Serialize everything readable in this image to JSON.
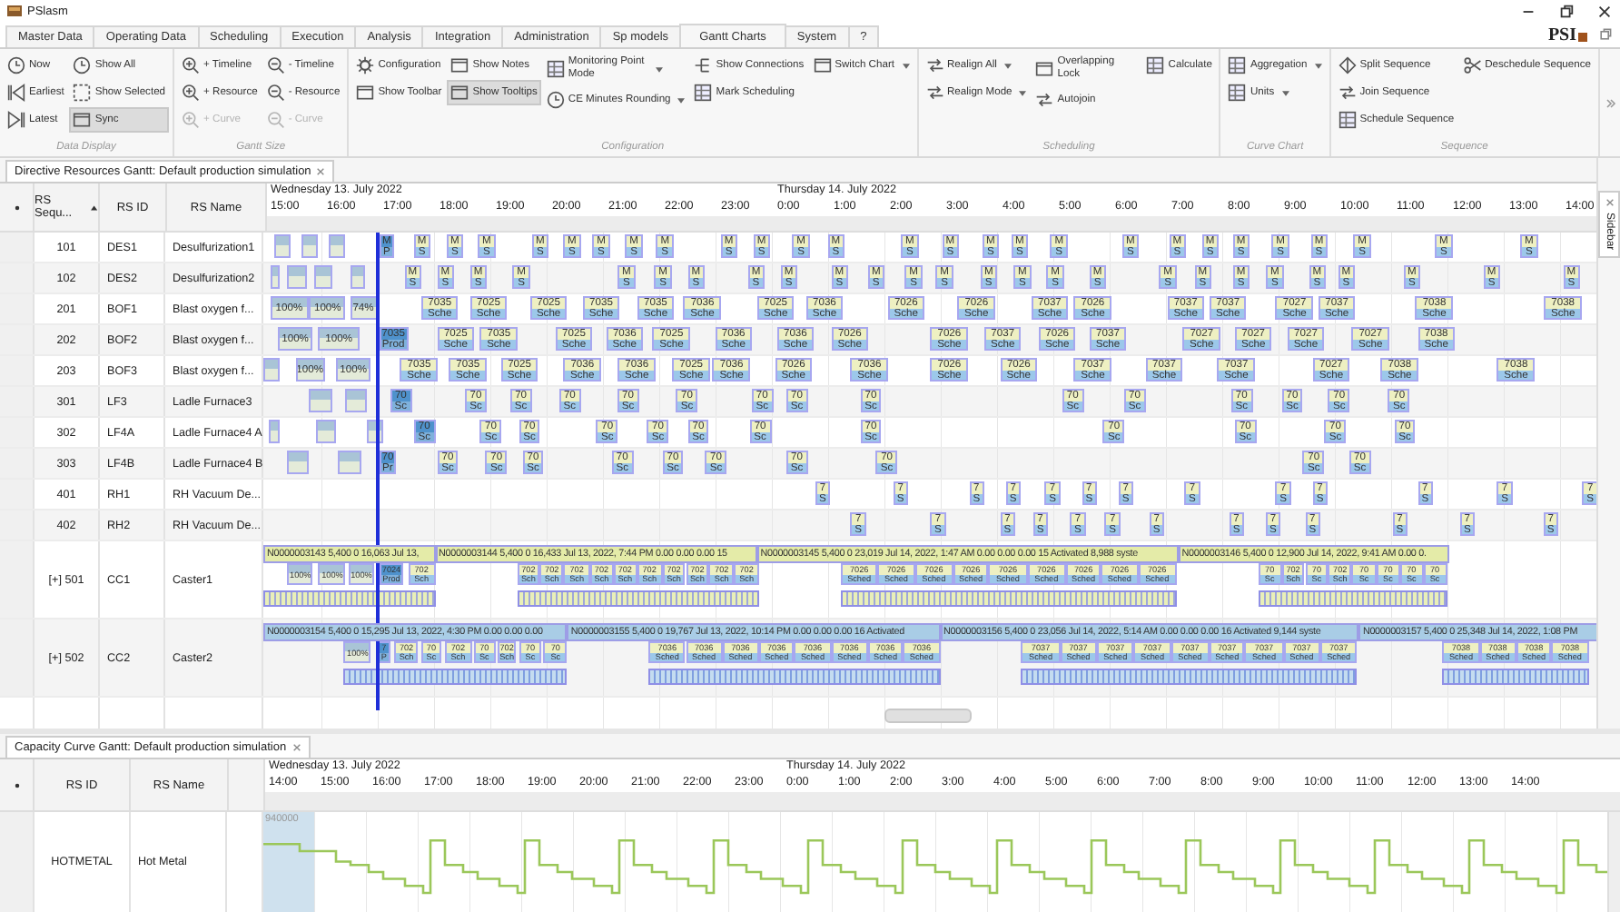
{
  "window": {
    "title": "PSlasm"
  },
  "logo": "PSI",
  "menu": [
    {
      "label": "Master Data",
      "selected": false
    },
    {
      "label": "Operating Data",
      "selected": false
    },
    {
      "label": "Scheduling",
      "selected": false
    },
    {
      "label": "Execution",
      "selected": false
    },
    {
      "label": "Analysis",
      "selected": false
    },
    {
      "label": "Integration",
      "selected": false
    },
    {
      "label": "Administration",
      "selected": false
    },
    {
      "label": "Sp models",
      "selected": false
    },
    {
      "label": "Gantt Charts",
      "selected": true
    },
    {
      "label": "System",
      "selected": false
    },
    {
      "label": "?",
      "selected": false
    }
  ],
  "ribbon": [
    {
      "label": "Data Display",
      "columns": [
        [
          {
            "label": "Now",
            "on": false,
            "disabled": false,
            "dropdown": false
          },
          {
            "label": "Earliest",
            "on": false,
            "disabled": false,
            "dropdown": false
          },
          {
            "label": "Latest",
            "on": false,
            "disabled": false,
            "dropdown": false
          }
        ],
        [
          {
            "label": "Show All",
            "on": false,
            "disabled": false,
            "dropdown": false
          },
          {
            "label": "Show Selected",
            "on": false,
            "disabled": false,
            "dropdown": false
          },
          {
            "label": "Sync",
            "on": true,
            "disabled": false,
            "dropdown": false
          }
        ]
      ]
    },
    {
      "label": "Gantt Size",
      "columns": [
        [
          {
            "label": "+ Timeline",
            "on": false,
            "disabled": false,
            "dropdown": false
          },
          {
            "label": "+ Resource",
            "on": false,
            "disabled": false,
            "dropdown": false
          },
          {
            "label": "+ Curve",
            "on": false,
            "disabled": true,
            "dropdown": false
          }
        ],
        [
          {
            "label": "- Timeline",
            "on": false,
            "disabled": false,
            "dropdown": false
          },
          {
            "label": "- Resource",
            "on": false,
            "disabled": false,
            "dropdown": false
          },
          {
            "label": "- Curve",
            "on": false,
            "disabled": true,
            "dropdown": false
          }
        ]
      ]
    },
    {
      "label": "Configuration",
      "columns": [
        [
          {
            "label": "Configuration",
            "on": false,
            "disabled": false,
            "dropdown": false
          },
          {
            "label": "Show Toolbar",
            "on": false,
            "disabled": false,
            "dropdown": false
          }
        ],
        [
          {
            "label": "Show Notes",
            "on": false,
            "disabled": false,
            "dropdown": false
          },
          {
            "label": "Show Tooltips",
            "on": true,
            "disabled": false,
            "dropdown": false
          }
        ],
        [
          {
            "label": "Monitoring Point Mode",
            "on": false,
            "disabled": false,
            "dropdown": true
          },
          {
            "label": "CE Minutes Rounding",
            "on": false,
            "disabled": false,
            "dropdown": true
          }
        ],
        [
          {
            "label": "Show Connections",
            "on": false,
            "disabled": false,
            "dropdown": false
          },
          {
            "label": "Mark Scheduling",
            "on": false,
            "disabled": false,
            "dropdown": false
          }
        ],
        [
          {
            "label": "Switch Chart",
            "on": false,
            "disabled": false,
            "dropdown": true
          }
        ]
      ]
    },
    {
      "label": "Scheduling",
      "columns": [
        [
          {
            "label": "Realign All",
            "on": false,
            "disabled": false,
            "dropdown": true
          },
          {
            "label": "Realign Mode",
            "on": false,
            "disabled": false,
            "dropdown": true
          }
        ],
        [
          {
            "label": "Overlapping Lock",
            "on": false,
            "disabled": false,
            "dropdown": false
          },
          {
            "label": "Autojoin",
            "on": false,
            "disabled": false,
            "dropdown": false
          }
        ],
        [
          {
            "label": "Calculate",
            "on": false,
            "disabled": false,
            "dropdown": false
          }
        ]
      ]
    },
    {
      "label": "Curve Chart",
      "columns": [
        [
          {
            "label": "Aggregation",
            "on": false,
            "disabled": false,
            "dropdown": true
          },
          {
            "label": "Units",
            "on": false,
            "disabled": false,
            "dropdown": true
          }
        ]
      ]
    },
    {
      "label": "Sequence",
      "columns": [
        [
          {
            "label": "Split Sequence",
            "on": false,
            "disabled": false,
            "dropdown": false
          },
          {
            "label": "Join Sequence",
            "on": false,
            "disabled": false,
            "dropdown": false
          },
          {
            "label": "Schedule Sequence",
            "on": false,
            "disabled": false,
            "dropdown": false
          }
        ],
        [
          {
            "label": "Deschedule Sequence",
            "on": false,
            "disabled": false,
            "dropdown": false
          }
        ]
      ]
    }
  ],
  "resources_gantt": {
    "title": "Directive Resources Gantt: Default production simulation",
    "columns": [
      "RS Sequ...",
      "RS ID",
      "RS Name"
    ],
    "days": [
      {
        "label": "Wednesday 13. July 2022",
        "hours": [
          "15:00",
          "16:00",
          "17:00",
          "18:00",
          "19:00",
          "20:00",
          "21:00",
          "22:00",
          "23:00"
        ]
      },
      {
        "label": "Thursday 14. July 2022",
        "hours": [
          "0:00",
          "1:00",
          "2:00",
          "3:00",
          "4:00",
          "5:00",
          "6:00",
          "7:00",
          "8:00",
          "9:00",
          "10:00",
          "11:00",
          "12:00",
          "13:00",
          "14:00"
        ]
      }
    ],
    "rows": [
      {
        "kind": "unit",
        "sequence": "101",
        "id": "DES1",
        "name": "Desulfurization1",
        "bars": [
          {
            "kind": "done"
          },
          {
            "kind": "done"
          },
          {
            "kind": "done"
          },
          {
            "kind": "active",
            "label": "M",
            "sub": "P"
          },
          {
            "kind": "plan",
            "label": "M",
            "sub": "S"
          },
          {
            "kind": "plan",
            "label": "M",
            "sub": "S"
          },
          {
            "kind": "plan",
            "label": "M",
            "sub": "S"
          },
          {
            "kind": "plan",
            "label": "M",
            "sub": "S"
          },
          {
            "kind": "plan",
            "label": "M",
            "sub": "S"
          },
          {
            "kind": "plan",
            "label": "M",
            "sub": "S"
          },
          {
            "kind": "plan",
            "label": "M",
            "sub": "S"
          },
          {
            "kind": "plan",
            "label": "M",
            "sub": "S"
          },
          {
            "kind": "plan",
            "label": "M",
            "sub": "S"
          },
          {
            "kind": "plan",
            "label": "M",
            "sub": "S"
          },
          {
            "kind": "plan",
            "label": "M",
            "sub": "S"
          },
          {
            "kind": "plan",
            "label": "M",
            "sub": "S"
          },
          {
            "kind": "plan",
            "label": "M",
            "sub": "S"
          },
          {
            "kind": "plan",
            "label": "M",
            "sub": "S"
          },
          {
            "kind": "plan",
            "label": "M",
            "sub": "S"
          },
          {
            "kind": "plan",
            "label": "M",
            "sub": "S"
          },
          {
            "kind": "plan",
            "label": "M",
            "sub": "S"
          },
          {
            "kind": "plan",
            "label": "M",
            "sub": "S"
          },
          {
            "kind": "plan",
            "label": "M",
            "sub": "S"
          },
          {
            "kind": "plan",
            "label": "M",
            "sub": "S"
          },
          {
            "kind": "plan",
            "label": "M",
            "sub": "S"
          },
          {
            "kind": "plan",
            "label": "M",
            "sub": "S"
          },
          {
            "kind": "plan",
            "label": "M",
            "sub": "S"
          },
          {
            "kind": "plan",
            "label": "M",
            "sub": "S"
          },
          {
            "kind": "plan",
            "label": "M",
            "sub": "S"
          },
          {
            "kind": "plan",
            "label": "M",
            "sub": "S"
          }
        ]
      },
      {
        "kind": "unit",
        "sequence": "102",
        "id": "DES2",
        "name": "Desulfurization2",
        "bars": [
          {
            "kind": "done"
          },
          {
            "kind": "done"
          },
          {
            "kind": "done"
          },
          {
            "kind": "done"
          },
          {
            "kind": "plan",
            "label": "M",
            "sub": "S"
          },
          {
            "kind": "plan",
            "label": "M",
            "sub": "S"
          },
          {
            "kind": "plan",
            "label": "M",
            "sub": "S"
          },
          {
            "kind": "plan",
            "label": "M",
            "sub": "S"
          },
          {
            "kind": "plan",
            "label": "M",
            "sub": "S"
          },
          {
            "kind": "plan",
            "label": "M",
            "sub": "S"
          },
          {
            "kind": "plan",
            "label": "M",
            "sub": "S"
          },
          {
            "kind": "plan",
            "label": "M",
            "sub": "S"
          },
          {
            "kind": "plan",
            "label": "M",
            "sub": "S"
          },
          {
            "kind": "plan",
            "label": "M",
            "sub": "S"
          },
          {
            "kind": "plan",
            "label": "M",
            "sub": "S"
          },
          {
            "kind": "plan",
            "label": "M",
            "sub": "S"
          },
          {
            "kind": "plan",
            "label": "M",
            "sub": "S"
          },
          {
            "kind": "plan",
            "label": "M",
            "sub": "S"
          },
          {
            "kind": "plan",
            "label": "M",
            "sub": "S"
          },
          {
            "kind": "plan",
            "label": "M",
            "sub": "S"
          },
          {
            "kind": "plan",
            "label": "M",
            "sub": "S"
          },
          {
            "kind": "plan",
            "label": "M",
            "sub": "S"
          },
          {
            "kind": "plan",
            "label": "M",
            "sub": "S"
          },
          {
            "kind": "plan",
            "label": "M",
            "sub": "S"
          },
          {
            "kind": "plan",
            "label": "M",
            "sub": "S"
          },
          {
            "kind": "plan",
            "label": "M",
            "sub": "S"
          },
          {
            "kind": "plan",
            "label": "M",
            "sub": "S"
          },
          {
            "kind": "plan",
            "label": "M",
            "sub": "S"
          },
          {
            "kind": "plan",
            "label": "M",
            "sub": "S"
          },
          {
            "kind": "plan",
            "label": "M",
            "sub": "S"
          }
        ]
      },
      {
        "kind": "unit",
        "sequence": "201",
        "id": "BOF1",
        "name": "Blast oxygen f...",
        "bars": [
          {
            "kind": "done",
            "label": "100%"
          },
          {
            "kind": "done",
            "label": "100%"
          },
          {
            "kind": "done",
            "label": "74%"
          },
          {
            "kind": "plan",
            "label": "7035",
            "sub": "Sche"
          },
          {
            "kind": "plan",
            "label": "7025",
            "sub": "Sche"
          },
          {
            "kind": "plan",
            "label": "7025",
            "sub": "Sche"
          },
          {
            "kind": "plan",
            "label": "7035",
            "sub": "Sche"
          },
          {
            "kind": "plan",
            "label": "7035",
            "sub": "Sche"
          },
          {
            "kind": "plan",
            "label": "7036",
            "sub": "Sche"
          },
          {
            "kind": "plan",
            "label": "7025",
            "sub": "Sche"
          },
          {
            "kind": "plan",
            "label": "7036",
            "sub": "Sche"
          },
          {
            "kind": "plan",
            "label": "7026",
            "sub": "Sche"
          },
          {
            "kind": "plan",
            "label": "7026",
            "sub": "Sche"
          },
          {
            "kind": "plan",
            "label": "7037",
            "sub": "Sche"
          },
          {
            "kind": "plan",
            "label": "7026",
            "sub": "Sche"
          },
          {
            "kind": "plan",
            "label": "7037",
            "sub": "Sche"
          },
          {
            "kind": "plan",
            "label": "7037",
            "sub": "Sche"
          },
          {
            "kind": "plan",
            "label": "7027",
            "sub": "Sche"
          },
          {
            "kind": "plan",
            "label": "7037",
            "sub": "Sche"
          },
          {
            "kind": "plan",
            "label": "7038",
            "sub": "Sche"
          },
          {
            "kind": "plan",
            "label": "7038",
            "sub": "Sche"
          }
        ]
      },
      {
        "kind": "unit",
        "sequence": "202",
        "id": "BOF2",
        "name": "Blast oxygen f...",
        "bars": [
          {
            "kind": "done",
            "label": "100%"
          },
          {
            "kind": "done",
            "label": "100%"
          },
          {
            "kind": "active",
            "label": "7035",
            "sub": "Prod"
          },
          {
            "kind": "plan",
            "label": "7025",
            "sub": "Sche"
          },
          {
            "kind": "plan",
            "label": "7035",
            "sub": "Sche"
          },
          {
            "kind": "plan",
            "label": "7025",
            "sub": "Sche"
          },
          {
            "kind": "plan",
            "label": "7036",
            "sub": "Sche"
          },
          {
            "kind": "plan",
            "label": "7025",
            "sub": "Sche"
          },
          {
            "kind": "plan",
            "label": "7036",
            "sub": "Sche"
          },
          {
            "kind": "plan",
            "label": "7036",
            "sub": "Sche"
          },
          {
            "kind": "plan",
            "label": "7026",
            "sub": "Sche"
          },
          {
            "kind": "plan",
            "label": "7026",
            "sub": "Sche"
          },
          {
            "kind": "plan",
            "label": "7037",
            "sub": "Sche"
          },
          {
            "kind": "plan",
            "label": "7026",
            "sub": "Sche"
          },
          {
            "kind": "plan",
            "label": "7037",
            "sub": "Sche"
          },
          {
            "kind": "plan",
            "label": "7027",
            "sub": "Sche"
          },
          {
            "kind": "plan",
            "label": "7027",
            "sub": "Sche"
          },
          {
            "kind": "plan",
            "label": "7027",
            "sub": "Sche"
          },
          {
            "kind": "plan",
            "label": "7027",
            "sub": "Sche"
          },
          {
            "kind": "plan",
            "label": "7038",
            "sub": "Sche"
          }
        ]
      },
      {
        "kind": "unit",
        "sequence": "203",
        "id": "BOF3",
        "name": "Blast oxygen f...",
        "bars": [
          {
            "kind": "done"
          },
          {
            "kind": "done",
            "label": "100%"
          },
          {
            "kind": "done",
            "label": "100%"
          },
          {
            "kind": "plan",
            "label": "7035",
            "sub": "Sche"
          },
          {
            "kind": "plan",
            "label": "7035",
            "sub": "Sche"
          },
          {
            "kind": "plan",
            "label": "7025",
            "sub": "Sche"
          },
          {
            "kind": "plan",
            "label": "7036",
            "sub": "Sche"
          },
          {
            "kind": "plan",
            "label": "7036",
            "sub": "Sche"
          },
          {
            "kind": "plan",
            "label": "7025",
            "sub": "Sche"
          },
          {
            "kind": "plan",
            "label": "7036",
            "sub": "Sche"
          },
          {
            "kind": "plan",
            "label": "7026",
            "sub": "Sche"
          },
          {
            "kind": "plan",
            "label": "7036",
            "sub": "Sche"
          },
          {
            "kind": "plan",
            "label": "7026",
            "sub": "Sche"
          },
          {
            "kind": "plan",
            "label": "7026",
            "sub": "Sche"
          },
          {
            "kind": "plan",
            "label": "7037",
            "sub": "Sche"
          },
          {
            "kind": "plan",
            "label": "7037",
            "sub": "Sche"
          },
          {
            "kind": "plan",
            "label": "7037",
            "sub": "Sche"
          },
          {
            "kind": "plan",
            "label": "7027",
            "sub": "Sche"
          },
          {
            "kind": "plan",
            "label": "7038",
            "sub": "Sche"
          },
          {
            "kind": "plan",
            "label": "7038",
            "sub": "Sche"
          }
        ]
      },
      {
        "kind": "unit",
        "sequence": "301",
        "id": "LF3",
        "name": "Ladle Furnace3",
        "bars": [
          {
            "kind": "done"
          },
          {
            "kind": "done"
          },
          {
            "kind": "active",
            "label": "70",
            "sub": "Sc"
          },
          {
            "kind": "plan",
            "label": "70",
            "sub": "Sc"
          },
          {
            "kind": "plan",
            "label": "70",
            "sub": "Sc"
          },
          {
            "kind": "plan",
            "label": "70",
            "sub": "Sc"
          },
          {
            "kind": "plan",
            "label": "70",
            "sub": "Sc"
          },
          {
            "kind": "plan",
            "label": "70",
            "sub": "Sc"
          },
          {
            "kind": "plan",
            "label": "70",
            "sub": "Sc"
          },
          {
            "kind": "plan",
            "label": "70",
            "sub": "Sc"
          },
          {
            "kind": "plan",
            "label": "70",
            "sub": "Sc"
          },
          {
            "kind": "plan",
            "label": "70",
            "sub": "Sc"
          },
          {
            "kind": "plan",
            "label": "70",
            "sub": "Sc"
          },
          {
            "kind": "plan",
            "label": "70",
            "sub": "Sc"
          },
          {
            "kind": "plan",
            "label": "70",
            "sub": "Sc"
          },
          {
            "kind": "plan",
            "label": "70",
            "sub": "Sc"
          },
          {
            "kind": "plan",
            "label": "70",
            "sub": "Sc"
          }
        ]
      },
      {
        "kind": "unit",
        "sequence": "302",
        "id": "LF4A",
        "name": "Ladle Furnace4 A",
        "bars": [
          {
            "kind": "done"
          },
          {
            "kind": "done"
          },
          {
            "kind": "done"
          },
          {
            "kind": "active",
            "label": "70",
            "sub": "Sc"
          },
          {
            "kind": "plan",
            "label": "70",
            "sub": "Sc"
          },
          {
            "kind": "plan",
            "label": "70",
            "sub": "Sc"
          },
          {
            "kind": "plan",
            "label": "70",
            "sub": "Sc"
          },
          {
            "kind": "plan",
            "label": "70",
            "sub": "Sc"
          },
          {
            "kind": "plan",
            "label": "70",
            "sub": "Sc"
          },
          {
            "kind": "plan",
            "label": "70",
            "sub": "Sc"
          },
          {
            "kind": "plan",
            "label": "70",
            "sub": "Sc"
          },
          {
            "kind": "plan",
            "label": "70",
            "sub": "Sc"
          },
          {
            "kind": "plan",
            "label": "70",
            "sub": "Sc"
          },
          {
            "kind": "plan",
            "label": "70",
            "sub": "Sc"
          },
          {
            "kind": "plan",
            "label": "70",
            "sub": "Sc"
          }
        ]
      },
      {
        "kind": "unit",
        "sequence": "303",
        "id": "LF4B",
        "name": "Ladle Furnace4 B",
        "bars": [
          {
            "kind": "done"
          },
          {
            "kind": "done"
          },
          {
            "kind": "active",
            "label": "70",
            "sub": "Pr"
          },
          {
            "kind": "plan",
            "label": "70",
            "sub": "Sc"
          },
          {
            "kind": "plan",
            "label": "70",
            "sub": "Sc"
          },
          {
            "kind": "plan",
            "label": "70",
            "sub": "Sc"
          },
          {
            "kind": "plan",
            "label": "70",
            "sub": "Sc"
          },
          {
            "kind": "plan",
            "label": "70",
            "sub": "Sc"
          },
          {
            "kind": "plan",
            "label": "70",
            "sub": "Sc"
          },
          {
            "kind": "plan",
            "label": "70",
            "sub": "Sc"
          },
          {
            "kind": "plan",
            "label": "70",
            "sub": "Sc"
          },
          {
            "kind": "plan",
            "label": "70",
            "sub": "Sc"
          },
          {
            "kind": "plan",
            "label": "70",
            "sub": "Sc"
          }
        ]
      },
      {
        "kind": "unit",
        "sequence": "401",
        "id": "RH1",
        "name": "RH Vacuum De...",
        "bars": [
          {
            "kind": "plan",
            "label": "7",
            "sub": "S"
          },
          {
            "kind": "plan",
            "label": "7",
            "sub": "S"
          },
          {
            "kind": "plan",
            "label": "7",
            "sub": "S"
          },
          {
            "kind": "plan",
            "label": "7",
            "sub": "S"
          },
          {
            "kind": "plan",
            "label": "7",
            "sub": "S"
          },
          {
            "kind": "plan",
            "label": "7",
            "sub": "S"
          },
          {
            "kind": "plan",
            "label": "7",
            "sub": "S"
          },
          {
            "kind": "plan",
            "label": "7",
            "sub": "S"
          },
          {
            "kind": "plan",
            "label": "7",
            "sub": "S"
          },
          {
            "kind": "plan",
            "label": "7",
            "sub": "S"
          },
          {
            "kind": "plan",
            "label": "7",
            "sub": "S"
          },
          {
            "kind": "plan",
            "label": "7",
            "sub": "S"
          },
          {
            "kind": "plan",
            "label": "7",
            "sub": "S"
          }
        ]
      },
      {
        "kind": "unit",
        "sequence": "402",
        "id": "RH2",
        "name": "RH Vacuum De...",
        "bars": [
          {
            "kind": "plan",
            "label": "7",
            "sub": "S"
          },
          {
            "kind": "plan",
            "label": "7",
            "sub": "S"
          },
          {
            "kind": "plan",
            "label": "7",
            "sub": "S"
          },
          {
            "kind": "plan",
            "label": "7",
            "sub": "S"
          },
          {
            "kind": "plan",
            "label": "7",
            "sub": "S"
          },
          {
            "kind": "plan",
            "label": "7",
            "sub": "S"
          },
          {
            "kind": "plan",
            "label": "7",
            "sub": "S"
          },
          {
            "kind": "plan",
            "label": "7",
            "sub": "S"
          },
          {
            "kind": "plan",
            "label": "7",
            "sub": "S"
          },
          {
            "kind": "plan",
            "label": "7",
            "sub": "S"
          },
          {
            "kind": "plan",
            "label": "7",
            "sub": "S"
          },
          {
            "kind": "plan",
            "label": "7",
            "sub": "S"
          },
          {
            "kind": "plan",
            "label": "7",
            "sub": "S"
          }
        ]
      },
      {
        "kind": "caster",
        "sequence": "[+] 501",
        "id": "CC1",
        "name": "Caster1",
        "orders": [
          {
            "color": "#e4eba8",
            "label": "N0000003143 5,400 0 16,063 Jul 13,"
          },
          {
            "color": "#e4eba8",
            "label": "N0000003144 5,400 0 16,433 Jul 13, 2022, 7:44 PM 0.00 0.00 0.00 15"
          },
          {
            "color": "#e4eba8",
            "label": "N0000003145 5,400 0 23,019 Jul 14, 2022, 1:47 AM 0.00 0.00 0.00 15 Activated 8,988 syste"
          },
          {
            "color": "#e4eba8",
            "label": "N0000003146 5,400 0 12,900 Jul 14, 2022, 9:41 AM 0.00 0."
          }
        ],
        "bars": [
          {
            "kind": "done",
            "label": "100%"
          },
          {
            "kind": "done",
            "label": "100%"
          },
          {
            "kind": "done",
            "label": "100%"
          },
          {
            "kind": "active",
            "label": "7024",
            "sub": "Prod"
          },
          {
            "kind": "plan",
            "label": "702",
            "sub": "Sch"
          },
          {
            "kind": "plan",
            "label": "702",
            "sub": "Sch"
          },
          {
            "kind": "plan",
            "label": "702",
            "sub": "Sch"
          },
          {
            "kind": "plan",
            "label": "702",
            "sub": "Sch"
          },
          {
            "kind": "plan",
            "label": "702",
            "sub": "Sch"
          },
          {
            "kind": "plan",
            "label": "702",
            "sub": "Sch"
          },
          {
            "kind": "plan",
            "label": "702",
            "sub": "Sch"
          },
          {
            "kind": "plan",
            "label": "702",
            "sub": "Sch"
          },
          {
            "kind": "plan",
            "label": "702",
            "sub": "Sch"
          },
          {
            "kind": "plan",
            "label": "702",
            "sub": "Sch"
          },
          {
            "kind": "plan",
            "label": "702",
            "sub": "Sch"
          },
          {
            "kind": "plan",
            "label": "7026",
            "sub": "Sched"
          },
          {
            "kind": "plan",
            "label": "7026",
            "sub": "Sched"
          },
          {
            "kind": "plan",
            "label": "7026",
            "sub": "Sched"
          },
          {
            "kind": "plan",
            "label": "7026",
            "sub": "Sched"
          },
          {
            "kind": "plan",
            "label": "7026",
            "sub": "Sched"
          },
          {
            "kind": "plan",
            "label": "7026",
            "sub": "Sched"
          },
          {
            "kind": "plan",
            "label": "7026",
            "sub": "Sched"
          },
          {
            "kind": "plan",
            "label": "7026",
            "sub": "Sched"
          },
          {
            "kind": "plan",
            "label": "7026",
            "sub": "Sched"
          },
          {
            "kind": "plan",
            "label": "70",
            "sub": "Sc"
          },
          {
            "kind": "plan",
            "label": "702",
            "sub": "Sch"
          },
          {
            "kind": "plan",
            "label": "70",
            "sub": "Sc"
          },
          {
            "kind": "plan",
            "label": "702",
            "sub": "Sch"
          },
          {
            "kind": "plan",
            "label": "70",
            "sub": "Sc"
          },
          {
            "kind": "plan",
            "label": "70",
            "sub": "Sc"
          },
          {
            "kind": "plan",
            "label": "70",
            "sub": "Sc"
          },
          {
            "kind": "plan",
            "label": "70",
            "sub": "Sc"
          }
        ]
      },
      {
        "kind": "caster",
        "sequence": "[+] 502",
        "id": "CC2",
        "name": "Caster2",
        "orders": [
          {
            "color": "#a9cde6",
            "label": "N0000003154 5,400 0 15,295 Jul 13, 2022, 4:30 PM 0.00 0.00 0.00"
          },
          {
            "color": "#a9cde6",
            "label": "N0000003155 5,400 0 19,767 Jul 13, 2022, 10:14 PM 0.00 0.00 0.00 16 Activated"
          },
          {
            "color": "#a9cde6",
            "label": "N0000003156 5,400 0 23,056 Jul 14, 2022, 5:14 AM 0.00 0.00 0.00 16 Activated 9,144 syste"
          },
          {
            "color": "#a9cde6",
            "label": "N0000003157 5,400 0 25,348 Jul 14, 2022, 1:08 PM"
          }
        ],
        "bars": [
          {
            "kind": "done",
            "label": "100%"
          },
          {
            "kind": "active",
            "label": "7",
            "sub": "P"
          },
          {
            "kind": "plan",
            "label": "702",
            "sub": "Sch"
          },
          {
            "kind": "plan",
            "label": "70",
            "sub": "Sc"
          },
          {
            "kind": "plan",
            "label": "702",
            "sub": "Sch"
          },
          {
            "kind": "plan",
            "label": "70",
            "sub": "Sc"
          },
          {
            "kind": "plan",
            "label": "702",
            "sub": "Sch"
          },
          {
            "kind": "plan",
            "label": "70",
            "sub": "Sc"
          },
          {
            "kind": "plan",
            "label": "70",
            "sub": "Sc"
          },
          {
            "kind": "plan",
            "label": "7036",
            "sub": "Sched"
          },
          {
            "kind": "plan",
            "label": "7036",
            "sub": "Sched"
          },
          {
            "kind": "plan",
            "label": "7036",
            "sub": "Sched"
          },
          {
            "kind": "plan",
            "label": "7036",
            "sub": "Sched"
          },
          {
            "kind": "plan",
            "label": "7036",
            "sub": "Sched"
          },
          {
            "kind": "plan",
            "label": "7036",
            "sub": "Sched"
          },
          {
            "kind": "plan",
            "label": "7036",
            "sub": "Sched"
          },
          {
            "kind": "plan",
            "label": "7036",
            "sub": "Sched"
          },
          {
            "kind": "plan",
            "label": "7037",
            "sub": "Sched"
          },
          {
            "kind": "plan",
            "label": "7037",
            "sub": "Sched"
          },
          {
            "kind": "plan",
            "label": "7037",
            "sub": "Sched"
          },
          {
            "kind": "plan",
            "label": "7037",
            "sub": "Sched"
          },
          {
            "kind": "plan",
            "label": "7037",
            "sub": "Sched"
          },
          {
            "kind": "plan",
            "label": "7037",
            "sub": "Sched"
          },
          {
            "kind": "plan",
            "label": "7037",
            "sub": "Sched"
          },
          {
            "kind": "plan",
            "label": "7037",
            "sub": "Sched"
          },
          {
            "kind": "plan",
            "label": "7037",
            "sub": "Sched"
          },
          {
            "kind": "plan",
            "label": "7038",
            "sub": "Sched"
          },
          {
            "kind": "plan",
            "label": "7038",
            "sub": "Sched"
          },
          {
            "kind": "plan",
            "label": "7038",
            "sub": "Sched"
          },
          {
            "kind": "plan",
            "label": "7038",
            "sub": "Sched"
          }
        ]
      }
    ]
  },
  "capacity_gantt": {
    "title": "Capacity Curve Gantt: Default production simulation",
    "columns": [
      "RS ID",
      "RS Name"
    ],
    "days": [
      {
        "label": "Wednesday 13. July 2022",
        "hours": [
          "14:00",
          "15:00",
          "16:00",
          "17:00",
          "18:00",
          "19:00",
          "20:00",
          "21:00",
          "22:00",
          "23:00"
        ]
      },
      {
        "label": "Thursday 14. July 2022",
        "hours": [
          "0:00",
          "1:00",
          "2:00",
          "3:00",
          "4:00",
          "5:00",
          "6:00",
          "7:00",
          "8:00",
          "9:00",
          "10:00",
          "11:00",
          "12:00",
          "13:00",
          "14:00"
        ]
      }
    ],
    "rows": [
      {
        "id": "HOTMETAL",
        "name": "Hot Metal",
        "curve_label": "940000"
      }
    ]
  },
  "sidebar_tab": "Sidebar"
}
